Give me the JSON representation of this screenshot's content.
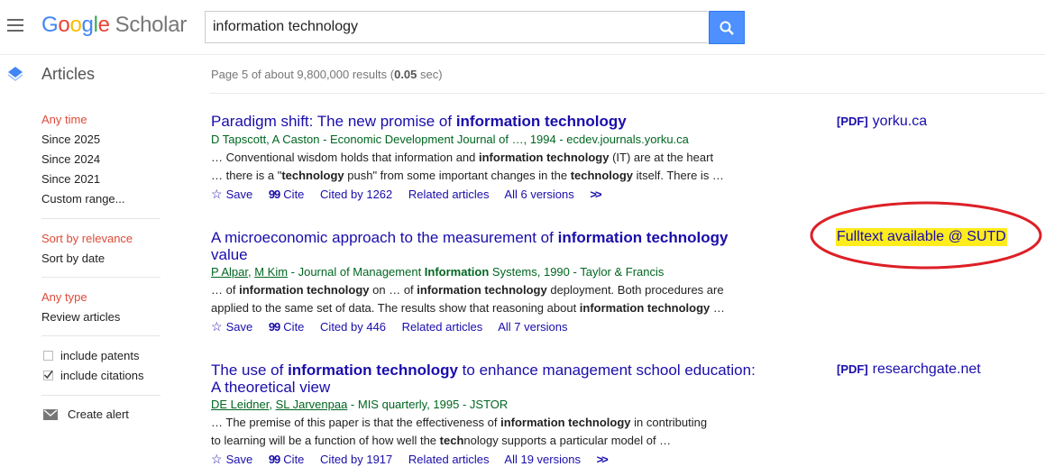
{
  "header": {
    "logo_google": "Google",
    "logo_scholar": "Scholar",
    "search_value": "information technology"
  },
  "subheader": {
    "section": "Articles",
    "results_prefix": "Page 5 of about 9,800,000 results (",
    "results_time": "0.05",
    "results_suffix": " sec)"
  },
  "sidebar": {
    "time_filters": [
      "Any time",
      "Since 2025",
      "Since 2024",
      "Since 2021",
      "Custom range..."
    ],
    "sort": [
      "Sort by relevance",
      "Sort by date"
    ],
    "type": [
      "Any type",
      "Review articles"
    ],
    "include_patents": "include patents",
    "include_citations": "include citations",
    "create_alert": "Create alert"
  },
  "results": [
    {
      "title_pre": "Paradigm shift: The new promise of ",
      "title_bold": "information technology",
      "title_post": "",
      "title_line2": "",
      "authors_text": "D Tapscott, A Caston",
      "source": " - Economic Development Journal of …, 1994 - ecdev.journals.yorku.ca",
      "snippet1_a": "… Conventional wisdom holds that information and ",
      "snippet1_b": "information technology",
      "snippet1_c": " (IT) are at the heart",
      "snippet2_a": "… there is a \"",
      "snippet2_b": "technology",
      "snippet2_c": " push\" from some important changes in the ",
      "snippet2_d": "technology",
      "snippet2_e": " itself. There is …",
      "save": "Save",
      "cite": "Cite",
      "cited_by": "Cited by 1262",
      "related": "Related articles",
      "versions": "All 6 versions",
      "side_tag": "[PDF]",
      "side_domain": "yorku.ca"
    },
    {
      "title_pre": "A microeconomic approach to the measurement of ",
      "title_bold": "information technology",
      "title_line2": "value",
      "author1": "P Alpar",
      "author_sep": ", ",
      "author2": "M Kim",
      "source_a": " - Journal of Management ",
      "source_b": "Information",
      "source_c": " Systems, 1990 - Taylor & Francis",
      "snippet1_a": "… of ",
      "snippet1_b": "information technology",
      "snippet1_c": " on … of ",
      "snippet1_d": "information technology",
      "snippet1_e": " deployment. Both procedures are",
      "snippet2_a": "applied to the same set of data. The results show that reasoning about ",
      "snippet2_b": "information technology",
      "snippet2_c": " …",
      "save": "Save",
      "cite": "Cite",
      "cited_by": "Cited by 446",
      "related": "Related articles",
      "versions": "All 7 versions",
      "fulltext": "Fulltext available @ SUTD"
    },
    {
      "title_pre": "The use of ",
      "title_bold": "information technology",
      "title_post": " to enhance management school education:",
      "title_line2": "A theoretical view",
      "author1": "DE Leidner",
      "author_sep": ", ",
      "author2": "SL Jarvenpaa",
      "source": " - MIS quarterly, 1995 - JSTOR",
      "snippet1_a": "… The premise of this paper is that the effectiveness of ",
      "snippet1_b": "information technology",
      "snippet1_c": " in contributing",
      "snippet2_a": "to learning will be a function of how well the ",
      "snippet2_b": "tech",
      "snippet2_c": "nology supports a particular model of …",
      "save": "Save",
      "cite": "Cite",
      "cited_by": "Cited by 1917",
      "related": "Related articles",
      "versions": "All 19 versions",
      "side_tag": "[PDF]",
      "side_domain": "researchgate.net"
    }
  ],
  "colors": {
    "link": "#1a0dab",
    "green": "#006621",
    "red": "#dd4b39",
    "highlight": "#ffec1d",
    "oval": "#dd1f26"
  }
}
